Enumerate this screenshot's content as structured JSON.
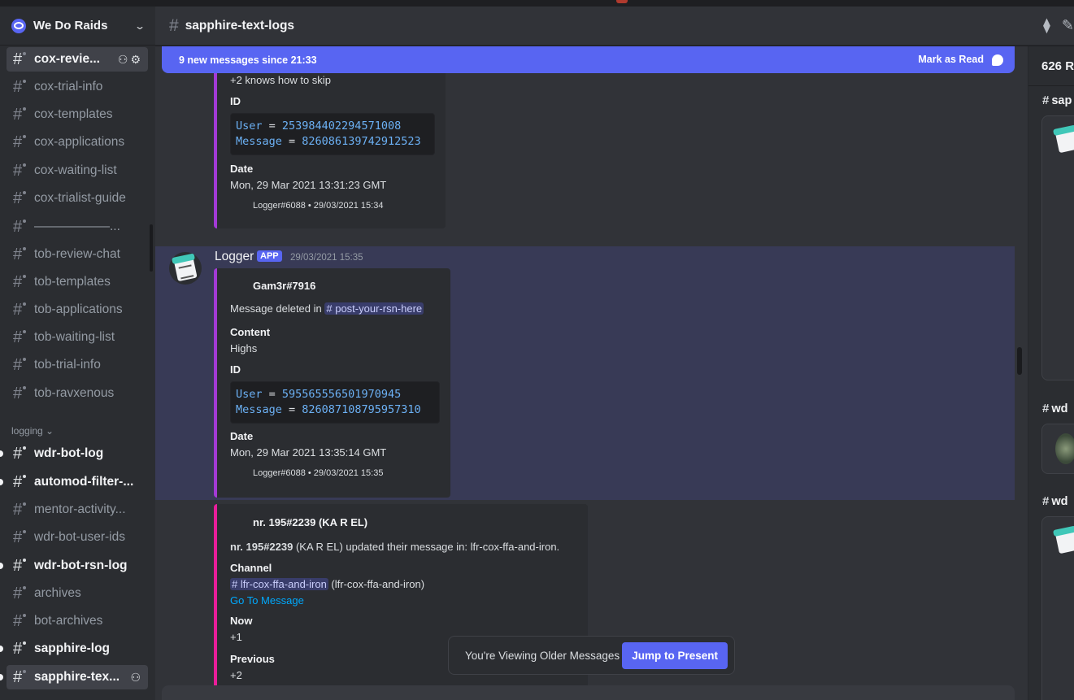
{
  "server": {
    "name": "We Do Raids"
  },
  "sidebar": {
    "channels": [
      {
        "label": "cox-revie...",
        "state": "active"
      },
      {
        "label": "cox-trial-info",
        "state": "normal"
      },
      {
        "label": "cox-templates",
        "state": "normal"
      },
      {
        "label": "cox-applications",
        "state": "normal"
      },
      {
        "label": "cox-waiting-list",
        "state": "normal"
      },
      {
        "label": "cox-trialist-guide",
        "state": "normal"
      },
      {
        "label": "——————...",
        "state": "normal"
      },
      {
        "label": "tob-review-chat",
        "state": "normal"
      },
      {
        "label": "tob-templates",
        "state": "normal"
      },
      {
        "label": "tob-applications",
        "state": "normal"
      },
      {
        "label": "tob-waiting-list",
        "state": "normal"
      },
      {
        "label": "tob-trial-info",
        "state": "normal"
      },
      {
        "label": "tob-ravxenous",
        "state": "normal"
      }
    ],
    "category_logging": "logging",
    "logging_channels": [
      {
        "label": "wdr-bot-log",
        "state": "unread"
      },
      {
        "label": "automod-filter-...",
        "state": "unread"
      },
      {
        "label": "mentor-activity...",
        "state": "normal"
      },
      {
        "label": "wdr-bot-user-ids",
        "state": "normal"
      },
      {
        "label": "wdr-bot-rsn-log",
        "state": "unread"
      },
      {
        "label": "archives",
        "state": "normal"
      },
      {
        "label": "bot-archives",
        "state": "normal"
      },
      {
        "label": "sapphire-log",
        "state": "unread"
      },
      {
        "label": "sapphire-tex...",
        "state": "active"
      }
    ]
  },
  "channel": {
    "title": "sapphire-text-logs"
  },
  "new_messages": {
    "text": "9 new messages since 21:33",
    "mark_label": "Mark as Read"
  },
  "msg1": {
    "skip_text": "+2 knows how to skip",
    "id_label": "ID",
    "user_key": "User",
    "user_val": "253984402294571008",
    "message_key": "Message",
    "message_val": "826086139742912523",
    "date_label": "Date",
    "date_val": "Mon, 29 Mar 2021 13:31:23 GMT",
    "footer": "Logger#6088 • 29/03/2021 15:34"
  },
  "msg2": {
    "author": "Logger",
    "badge": "APP",
    "timestamp": "29/03/2021 15:35",
    "embed_author": "Gam3r#7916",
    "deleted_prefix": "Message deleted in",
    "deleted_channel": "# post-your-rsn-here",
    "content_label": "Content",
    "content_val": "Highs",
    "id_label": "ID",
    "user_key": "User",
    "user_val": "595565556501970945",
    "message_key": "Message",
    "message_val": "826087108795957310",
    "date_label": "Date",
    "date_val": "Mon, 29 Mar 2021 13:35:14 GMT",
    "footer": "Logger#6088 • 29/03/2021 15:35"
  },
  "msg3": {
    "embed_author": "nr. 195#2239 (KA R EL)",
    "updated_bold": "nr. 195#2239",
    "updated_rest": " (KA R EL) updated their message in: lfr-cox-ffa-and-iron.",
    "channel_label": "Channel",
    "channel_mention": "# lfr-cox-ffa-and-iron",
    "channel_rest": " (lfr-cox-ffa-and-iron)",
    "goto": "Go To Message",
    "now_label": "Now",
    "now_val": "+1",
    "prev_label": "Previous",
    "prev_val": "+2"
  },
  "older": {
    "text": "You're Viewing Older Messages",
    "jump": "Jump to Present"
  },
  "right_panel": {
    "count": "626 R",
    "results": [
      {
        "channel": "sap"
      },
      {
        "channel": "wd"
      },
      {
        "channel": "wd"
      }
    ]
  },
  "colors": {
    "accent": "#5865f2",
    "embed_purple": "#a33ad6",
    "embed_pink": "#e91e9a",
    "highlight": "#383a56"
  }
}
